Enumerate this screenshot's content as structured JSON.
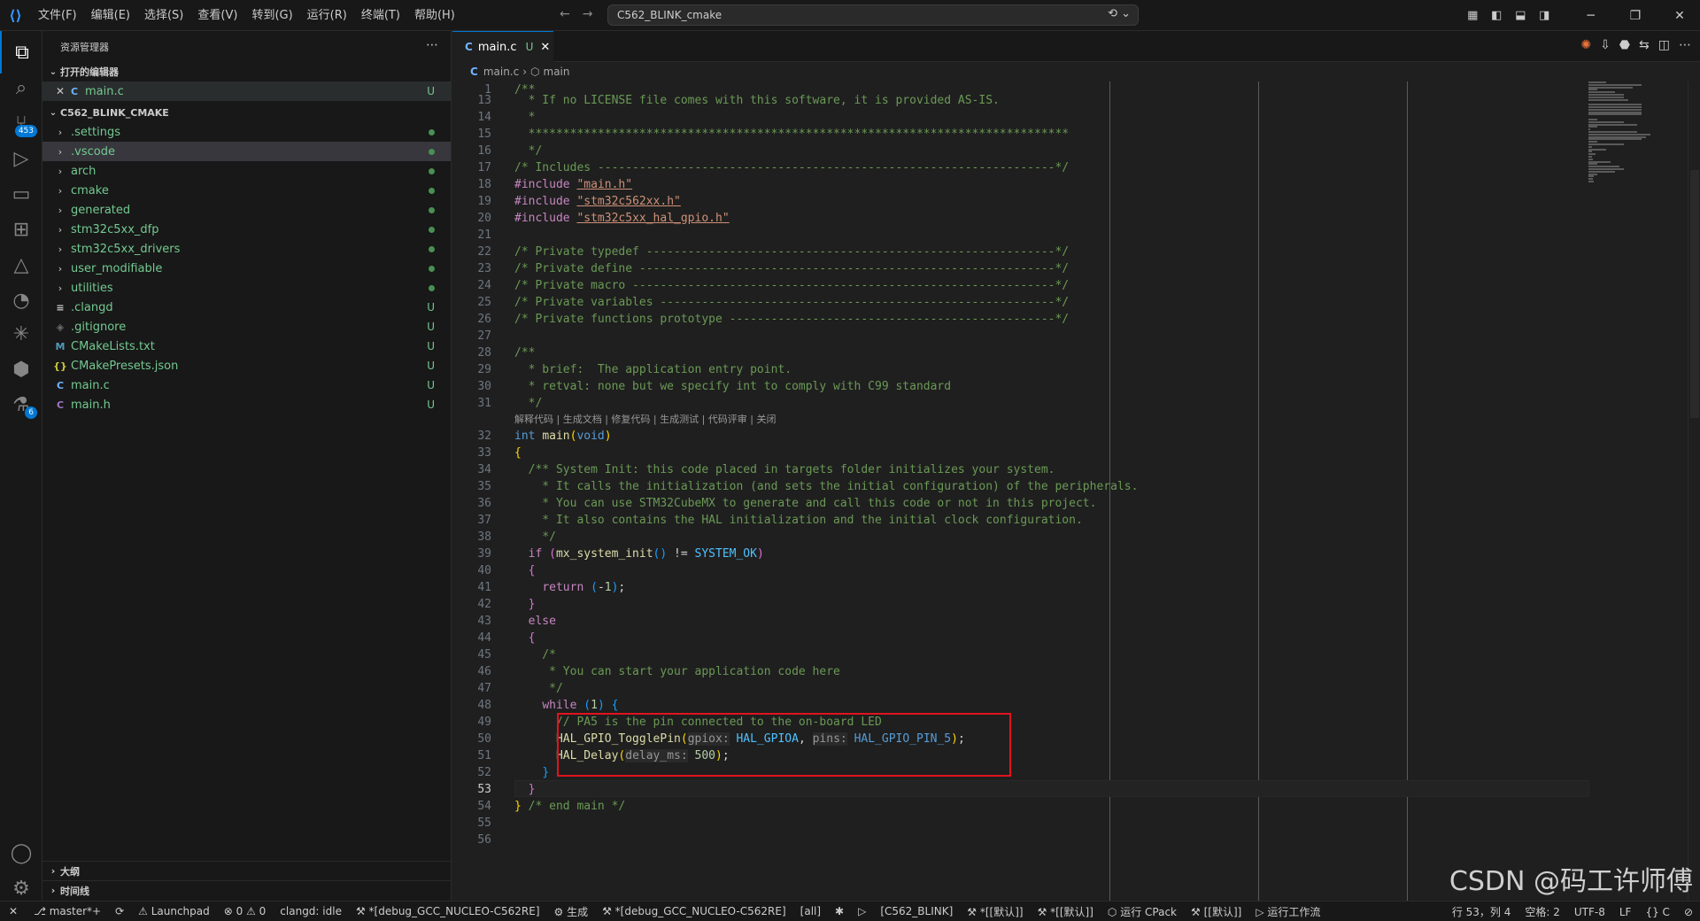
{
  "titlebar": {
    "menu": [
      "文件(F)",
      "编辑(E)",
      "选择(S)",
      "查看(V)",
      "转到(G)",
      "运行(R)",
      "终端(T)",
      "帮助(H)"
    ],
    "command_center": "C562_BLINK_cmake",
    "window_buttons": [
      "─",
      "❐",
      "✕"
    ]
  },
  "activitybar": {
    "items": [
      {
        "name": "explorer-icon",
        "glyph": "⧉"
      },
      {
        "name": "search-icon",
        "glyph": "⌕"
      },
      {
        "name": "source-control-icon",
        "glyph": "⑂",
        "badge": "453"
      },
      {
        "name": "run-debug-icon",
        "glyph": "▷"
      },
      {
        "name": "remote-explorer-icon",
        "glyph": "▭"
      },
      {
        "name": "extensions-icon",
        "glyph": "⊞"
      },
      {
        "name": "cmake-icon",
        "glyph": "△"
      },
      {
        "name": "timer-icon",
        "glyph": "◔"
      },
      {
        "name": "asterisk-icon",
        "glyph": "✳"
      },
      {
        "name": "cube-icon",
        "glyph": "⬢"
      },
      {
        "name": "flask-icon",
        "glyph": "⚗",
        "badge": "6"
      }
    ],
    "bottom": [
      {
        "name": "account-icon",
        "glyph": "◯"
      },
      {
        "name": "settings-gear-icon",
        "glyph": "⚙"
      }
    ]
  },
  "sidebar": {
    "title": "资源管理器",
    "open_editors": {
      "label": "打开的编辑器",
      "items": [
        {
          "name": "main.c",
          "status": "U"
        }
      ]
    },
    "project": {
      "label": "C562_BLINK_CMAKE",
      "items": [
        {
          "name": ".settings",
          "folder": true,
          "status": "dot"
        },
        {
          "name": ".vscode",
          "folder": true,
          "status": "dot",
          "selected": true
        },
        {
          "name": "arch",
          "folder": true,
          "status": "dot"
        },
        {
          "name": "cmake",
          "folder": true,
          "status": "dot"
        },
        {
          "name": "generated",
          "folder": true,
          "status": "dot"
        },
        {
          "name": "stm32c5xx_dfp",
          "folder": true,
          "status": "dot"
        },
        {
          "name": "stm32c5xx_drivers",
          "folder": true,
          "status": "dot"
        },
        {
          "name": "user_modifiable",
          "folder": true,
          "status": "dot"
        },
        {
          "name": "utilities",
          "folder": true,
          "status": "dot"
        },
        {
          "name": ".clangd",
          "icon": "≡",
          "icon_color": "#cccccc",
          "status": "U"
        },
        {
          "name": ".gitignore",
          "icon": "◈",
          "icon_color": "#6d6d6d",
          "status": "U"
        },
        {
          "name": "CMakeLists.txt",
          "icon": "M",
          "icon_color": "#519aba",
          "status": "U"
        },
        {
          "name": "CMakePresets.json",
          "icon": "{}",
          "icon_color": "#cbcb41",
          "status": "U"
        },
        {
          "name": "main.c",
          "icon": "C",
          "icon_color": "#6fb3ff",
          "status": "U"
        },
        {
          "name": "main.h",
          "icon": "C",
          "icon_color": "#a074c4",
          "status": "U"
        }
      ]
    },
    "outline_label": "大纲",
    "timeline_label": "时间线"
  },
  "editor": {
    "tab": {
      "label": "main.c",
      "status": "U"
    },
    "breadcrumb": {
      "file": "main.c",
      "symbol": "main"
    },
    "codelens": "解释代码 | 生成文档 | 修复代码 | 生成测试 | 代码评审 | 关闭"
  },
  "statusbar": {
    "left": [
      "✕",
      "⎇ master*+",
      "⟳",
      "⚠ Launchpad",
      "⊗ 0 ⚠ 0",
      "clangd: idle",
      "⚒ *[debug_GCC_NUCLEO-C562RE]",
      "⚙ 生成",
      "⚒ *[debug_GCC_NUCLEO-C562RE]",
      "[all]",
      "✱",
      "▷",
      "[C562_BLINK]",
      "⚒ *[[默认]]",
      "⚒ *[[默认]]",
      "⬡ 运行 CPack",
      "⚒ [[默认]]",
      "▷ 运行工作流"
    ],
    "right": [
      "行 53，列 4",
      "空格: 2",
      "UTF-8",
      "LF",
      "{} C",
      "⊘"
    ]
  },
  "watermark": "CSDN @码工许师傅"
}
